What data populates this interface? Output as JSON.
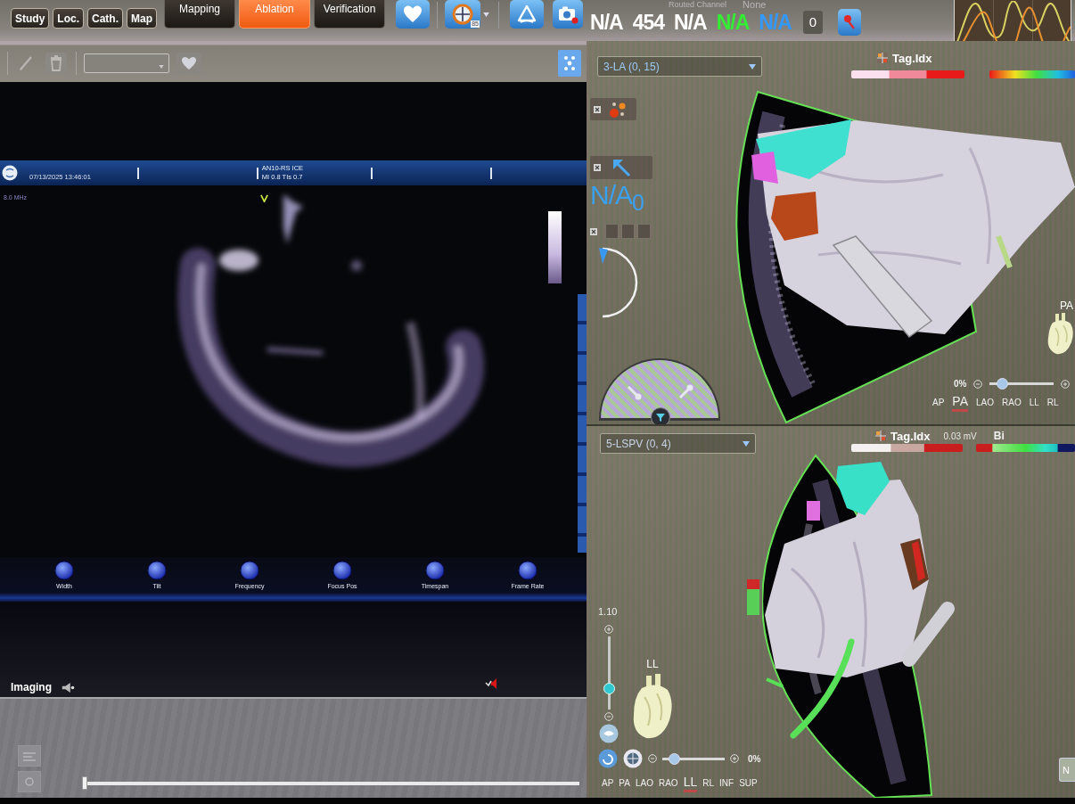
{
  "top_toolbar": {
    "tabs": [
      {
        "label": "Study",
        "selected": false
      },
      {
        "label": "Loc.",
        "selected": false
      },
      {
        "label": "Cath.",
        "selected": false
      },
      {
        "label": "Map",
        "selected": false
      }
    ],
    "modes": [
      {
        "label": "Mapping",
        "selected": false
      },
      {
        "label": "Ablation",
        "selected": true
      },
      {
        "label": "Verification",
        "selected": false
      }
    ],
    "target_badge": "85",
    "routed_channel": {
      "label": "Routed Channel",
      "value": "None"
    },
    "readouts": [
      {
        "text": "N/A",
        "color": "#ffffff"
      },
      {
        "text": "454",
        "color": "#ffffff"
      },
      {
        "text": "N/A",
        "color": "#ffffff"
      },
      {
        "text": "N/A",
        "color": "#33ee33"
      },
      {
        "text": "N/A",
        "color": "#3399ff"
      }
    ],
    "counter": "0"
  },
  "imaging_panel": {
    "date_time": "07/13/2025 13:46:01",
    "probe": "AN10-RS ICE",
    "indices": "MI 0.8  TIs 0.7",
    "frequency": "8.0 MHz",
    "knobs": [
      "Width",
      "Tilt",
      "Frequency",
      "Focus Pos",
      "Timespan",
      "Frame Rate"
    ],
    "title": "Imaging",
    "timeline": {
      "level": 0
    }
  },
  "tool_column": {
    "value": "N/A$_{0}$"
  },
  "map_views": [
    {
      "map": "3-LA (0, 15)",
      "legend": "Tag.Idx",
      "orientation": "PA",
      "zoom": {
        "label": "0%",
        "level": 0.12
      },
      "views": [
        {
          "label": "AP",
          "selected": false
        },
        {
          "label": "PA",
          "selected": true
        },
        {
          "label": "LAO",
          "selected": false
        },
        {
          "label": "RAO",
          "selected": false
        },
        {
          "label": "LL",
          "selected": false
        },
        {
          "label": "RL",
          "selected": false
        }
      ]
    },
    {
      "map": "5-LSPV (0, 4)",
      "legend": "Tag.Idx",
      "voltage": "0.03 mV",
      "signal": "Bi",
      "orientation": "LL",
      "scale": {
        "label": "1.10",
        "level": 0.25
      },
      "zoom": {
        "label": "0%",
        "level": 0.12
      },
      "views": [
        {
          "label": "AP",
          "selected": false
        },
        {
          "label": "PA",
          "selected": false
        },
        {
          "label": "LAO",
          "selected": false
        },
        {
          "label": "RAO",
          "selected": false
        },
        {
          "label": "LL",
          "selected": true
        },
        {
          "label": "RL",
          "selected": false
        },
        {
          "label": "INF",
          "selected": false
        },
        {
          "label": "SUP",
          "selected": false
        }
      ],
      "corner_button": "N"
    }
  ]
}
